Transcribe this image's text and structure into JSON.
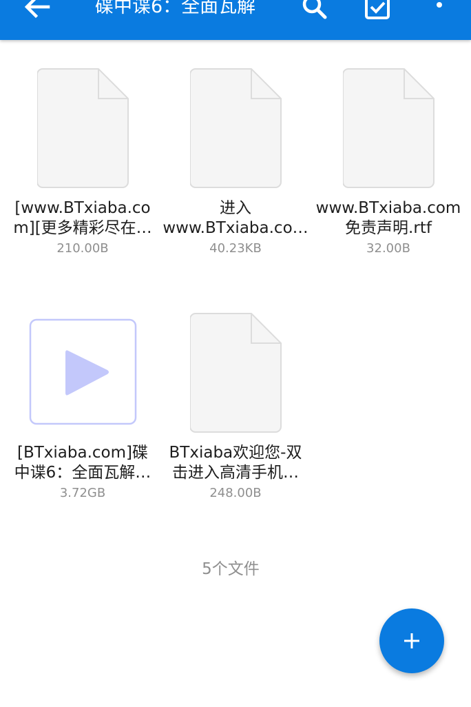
{
  "header": {
    "title": "碟中谍6：全面瓦解",
    "back_icon": "back-arrow-icon",
    "search_icon": "search-icon",
    "select_icon": "checkbox-icon",
    "more_icon": "more-vert-icon"
  },
  "files": [
    {
      "name_line1": "[www.BTxiaba.co",
      "name_line2": "m][更多精彩尽在…",
      "size": "210.00B",
      "icon": "document-icon"
    },
    {
      "name_line1": "进入",
      "name_line2": "www.BTxiaba.co…",
      "size": "40.23KB",
      "icon": "document-icon"
    },
    {
      "name_line1": "www.BTxiaba.com",
      "name_line2": "免责声明.rtf",
      "size": "32.00B",
      "icon": "document-icon"
    },
    {
      "name_line1": "[BTxiaba.com]碟",
      "name_line2": "中谍6：全面瓦解…",
      "size": "3.72GB",
      "icon": "video-play-icon"
    },
    {
      "name_line1": "BTxiaba欢迎您-双",
      "name_line2": "击进入高清手机…",
      "size": "248.00B",
      "icon": "document-icon"
    }
  ],
  "footer": {
    "count": "5个文件"
  },
  "fab": {
    "icon": "plus-icon"
  },
  "colors": {
    "primary": "#0a7be0",
    "video_accent": "#c3c8fb",
    "doc_fill": "#f5f5f5",
    "doc_stroke": "#dcdcdc"
  }
}
